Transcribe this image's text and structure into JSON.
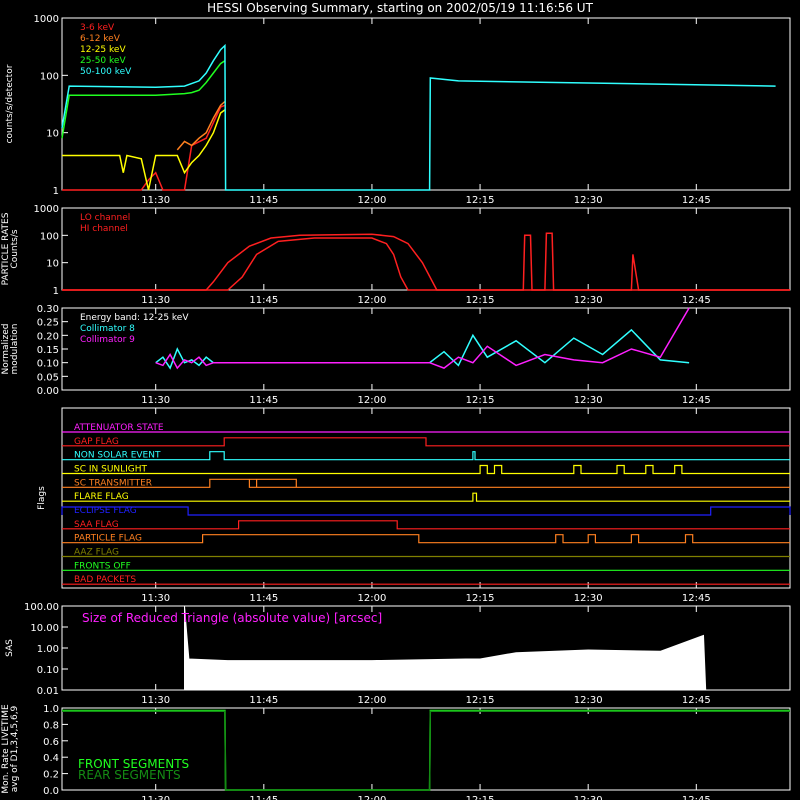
{
  "title": "HESSI Observing Summary, starting on 2002/05/19 11:16:56 UT",
  "time_axis": {
    "ticks": [
      "11:30",
      "11:45",
      "12:00",
      "12:15",
      "12:30",
      "12:45"
    ],
    "tick_minutes": [
      30,
      45,
      60,
      75,
      90,
      105
    ],
    "range_minutes": [
      17,
      118
    ]
  },
  "colors": {
    "bg": "#000000",
    "axes": "#ffffff",
    "red": "#ff2020",
    "orange": "#ff8020",
    "yellow": "#ffff00",
    "green": "#20ff20",
    "cyan": "#30ffff",
    "magenta": "#ff20ff",
    "blue": "#2020ff"
  },
  "chart_data": [
    {
      "type": "line",
      "ylabel": "counts/s/detector",
      "yscale": "log",
      "ylim": [
        1,
        1000
      ],
      "yticks": [
        "1",
        "10",
        "100",
        "1000"
      ],
      "series": [
        {
          "name": "3-6 keV",
          "color": "#ff2020",
          "points": [
            [
              17,
              1
            ],
            [
              28,
              1
            ],
            [
              29,
              1.5
            ],
            [
              30,
              2
            ],
            [
              31,
              1
            ],
            [
              34,
              1
            ],
            [
              35,
              6
            ],
            [
              37,
              8
            ],
            [
              38,
              15
            ],
            [
              39,
              28
            ],
            [
              39.6,
              30
            ]
          ]
        },
        {
          "name": "6-12 keV",
          "color": "#ff8020",
          "points": [
            [
              33,
              5
            ],
            [
              34,
              7
            ],
            [
              35,
              6
            ],
            [
              36,
              8
            ],
            [
              37,
              10
            ],
            [
              38,
              18
            ],
            [
              39,
              30
            ],
            [
              39.6,
              35
            ]
          ]
        },
        {
          "name": "12-25 keV",
          "color": "#ffff00",
          "points": [
            [
              17,
              4
            ],
            [
              25,
              4
            ],
            [
              25.5,
              2
            ],
            [
              26,
              4
            ],
            [
              28,
              3.5
            ],
            [
              29,
              1
            ],
            [
              30,
              4
            ],
            [
              33,
              4
            ],
            [
              34,
              2
            ],
            [
              35,
              3
            ],
            [
              36,
              4
            ],
            [
              37,
              6
            ],
            [
              38,
              10
            ],
            [
              39,
              22
            ],
            [
              39.6,
              25
            ]
          ]
        },
        {
          "name": "25-50 keV",
          "color": "#20ff20",
          "points": [
            [
              17,
              8
            ],
            [
              18,
              45
            ],
            [
              25,
              45
            ],
            [
              30,
              45
            ],
            [
              34,
              48
            ],
            [
              35,
              50
            ],
            [
              36,
              55
            ],
            [
              37,
              75
            ],
            [
              38,
              110
            ],
            [
              39,
              160
            ],
            [
              39.6,
              180
            ]
          ]
        },
        {
          "name": "50-100 keV",
          "color": "#30ffff",
          "points": [
            [
              17,
              12
            ],
            [
              18,
              65
            ],
            [
              30,
              62
            ],
            [
              34,
              65
            ],
            [
              36,
              80
            ],
            [
              37,
              110
            ],
            [
              38,
              180
            ],
            [
              39,
              280
            ],
            [
              39.6,
              330
            ],
            [
              39.7,
              1
            ],
            [
              68,
              1
            ],
            [
              68.1,
              90
            ],
            [
              72,
              80
            ],
            [
              116,
              65
            ]
          ]
        }
      ]
    },
    {
      "type": "line",
      "ylabel": "PARTICLE RATES Counts/s",
      "yscale": "log",
      "ylim": [
        1,
        1000
      ],
      "yticks": [
        "1",
        "10",
        "100",
        "1000"
      ],
      "series": [
        {
          "name": "LO channel",
          "color": "#ff2020",
          "points": [
            [
              17,
              1
            ],
            [
              37,
              1
            ],
            [
              38,
              2
            ],
            [
              40,
              10
            ],
            [
              43,
              40
            ],
            [
              46,
              80
            ],
            [
              50,
              100
            ],
            [
              60,
              110
            ],
            [
              63,
              90
            ],
            [
              65,
              50
            ],
            [
              67,
              10
            ],
            [
              69,
              1
            ],
            [
              81,
              1
            ],
            [
              81.2,
              100
            ],
            [
              82,
              100
            ],
            [
              82.2,
              1
            ],
            [
              84,
              1
            ],
            [
              84.2,
              120
            ],
            [
              85,
              120
            ],
            [
              85.2,
              1
            ],
            [
              96,
              1
            ],
            [
              96.2,
              20
            ],
            [
              97,
              1
            ],
            [
              118,
              1
            ]
          ]
        },
        {
          "name": "HI channel",
          "color": "#ff2020",
          "points": [
            [
              17,
              1
            ],
            [
              40,
              1
            ],
            [
              42,
              3
            ],
            [
              44,
              20
            ],
            [
              47,
              60
            ],
            [
              52,
              80
            ],
            [
              60,
              80
            ],
            [
              62,
              50
            ],
            [
              63,
              20
            ],
            [
              64,
              3
            ],
            [
              65,
              1
            ],
            [
              118,
              1
            ]
          ]
        }
      ]
    },
    {
      "type": "line",
      "ylabel": "Normalized modulation",
      "yscale": "linear",
      "ylim": [
        0,
        0.3
      ],
      "yticks": [
        "0.00",
        "0.05",
        "0.10",
        "0.15",
        "0.20",
        "0.25",
        "0.30"
      ],
      "band_label": "Energy band: 12-25 keV",
      "series": [
        {
          "name": "Collimator 8",
          "color": "#30ffff",
          "points": [
            [
              30,
              0.1
            ],
            [
              31,
              0.12
            ],
            [
              32,
              0.08
            ],
            [
              33,
              0.15
            ],
            [
              34,
              0.1
            ],
            [
              35,
              0.11
            ],
            [
              36,
              0.09
            ],
            [
              37,
              0.12
            ],
            [
              38,
              0.1
            ],
            [
              68,
              0.1
            ],
            [
              70,
              0.14
            ],
            [
              72,
              0.09
            ],
            [
              74,
              0.2
            ],
            [
              76,
              0.12
            ],
            [
              80,
              0.18
            ],
            [
              84,
              0.1
            ],
            [
              88,
              0.19
            ],
            [
              92,
              0.13
            ],
            [
              96,
              0.22
            ],
            [
              100,
              0.11
            ],
            [
              104,
              0.1
            ]
          ]
        },
        {
          "name": "Collimator 9",
          "color": "#ff20ff",
          "points": [
            [
              30,
              0.1
            ],
            [
              31,
              0.09
            ],
            [
              32,
              0.13
            ],
            [
              33,
              0.08
            ],
            [
              34,
              0.11
            ],
            [
              35,
              0.1
            ],
            [
              36,
              0.12
            ],
            [
              37,
              0.09
            ],
            [
              38,
              0.1
            ],
            [
              68,
              0.1
            ],
            [
              70,
              0.08
            ],
            [
              72,
              0.12
            ],
            [
              74,
              0.1
            ],
            [
              76,
              0.16
            ],
            [
              80,
              0.09
            ],
            [
              84,
              0.13
            ],
            [
              88,
              0.11
            ],
            [
              92,
              0.1
            ],
            [
              96,
              0.15
            ],
            [
              100,
              0.12
            ],
            [
              104,
              0.3
            ]
          ]
        }
      ]
    },
    {
      "type": "line",
      "ylabel": "Flags",
      "flags": [
        {
          "name": "ATTENUATOR STATE",
          "color": "#ff20ff",
          "transitions": []
        },
        {
          "name": "GAP FLAG",
          "color": "#ff2020",
          "transitions": [
            [
              39.5,
              67.5
            ]
          ]
        },
        {
          "name": "NON SOLAR EVENT",
          "color": "#30ffff",
          "transitions": [
            [
              37.5,
              39.5
            ],
            [
              74,
              74.3
            ]
          ]
        },
        {
          "name": "SC IN SUNLIGHT",
          "color": "#ffff00",
          "transitions": [
            [
              75,
              76
            ],
            [
              77,
              78
            ],
            [
              88,
              89
            ],
            [
              94,
              95
            ],
            [
              98,
              99
            ],
            [
              102,
              103
            ]
          ]
        },
        {
          "name": "SC TRANSMITTER",
          "color": "#ff8020",
          "transitions": [
            [
              37.5,
              49.5
            ],
            [
              43,
              44
            ]
          ]
        },
        {
          "name": "FLARE FLAG",
          "color": "#ffff00",
          "transitions": [
            [
              74,
              74.5
            ]
          ]
        },
        {
          "name": "ECLIPSE FLAG",
          "color": "#2020ff",
          "transitions": [
            [
              17,
              34.5
            ],
            [
              107,
              118
            ]
          ]
        },
        {
          "name": "SAA FLAG",
          "color": "#ff2020",
          "transitions": [
            [
              41.5,
              63.5
            ]
          ]
        },
        {
          "name": "PARTICLE FLAG",
          "color": "#ff8020",
          "transitions": [
            [
              36.5,
              66.5
            ],
            [
              85.5,
              86.5
            ],
            [
              90,
              91
            ],
            [
              96,
              97
            ],
            [
              103.5,
              104.5
            ]
          ]
        },
        {
          "name": "AAZ FLAG",
          "color": "#808000",
          "transitions": []
        },
        {
          "name": "FRONTS OFF",
          "color": "#20ff20",
          "transitions": []
        },
        {
          "name": "BAD PACKETS",
          "color": "#ff2020",
          "transitions": []
        }
      ]
    },
    {
      "type": "area",
      "ylabel": "SAS",
      "yscale": "log",
      "ylim": [
        0.01,
        100
      ],
      "yticks": [
        "0.01",
        "0.10",
        "1.00",
        "10.00",
        "100.00"
      ],
      "annotation": "Size of Reduced Triangle (absolute value) [arcsec]",
      "series": [
        {
          "name": "",
          "color": "#ffffff",
          "points": [
            [
              34,
              100
            ],
            [
              34.3,
              5
            ],
            [
              34.6,
              0.3
            ],
            [
              40,
              0.25
            ],
            [
              60,
              0.25
            ],
            [
              73,
              0.3
            ],
            [
              75,
              0.3
            ],
            [
              80,
              0.6
            ],
            [
              90,
              0.8
            ],
            [
              100,
              0.7
            ],
            [
              106,
              4
            ],
            [
              106.3,
              0.01
            ]
          ]
        }
      ]
    },
    {
      "type": "line",
      "ylabel": "Mon. Rate LIVETIME avg of D1,3,4,5,6,9",
      "yscale": "linear",
      "ylim": [
        0,
        1
      ],
      "yticks": [
        "0.0",
        "0.2",
        "0.4",
        "0.6",
        "0.8",
        "1.0"
      ],
      "series": [
        {
          "name": "FRONT SEGMENTS",
          "color": "#20ff20",
          "points": [
            [
              17,
              0.97
            ],
            [
              39.6,
              0.97
            ],
            [
              39.7,
              0
            ],
            [
              68,
              0
            ],
            [
              68.1,
              0.97
            ],
            [
              118,
              0.97
            ]
          ]
        },
        {
          "name": "REAR SEGMENTS",
          "color": "#148c14",
          "points": [
            [
              17,
              0.96
            ],
            [
              39.6,
              0.96
            ],
            [
              39.7,
              0
            ],
            [
              68,
              0
            ],
            [
              68.1,
              0.96
            ],
            [
              118,
              0.96
            ]
          ]
        }
      ]
    }
  ]
}
